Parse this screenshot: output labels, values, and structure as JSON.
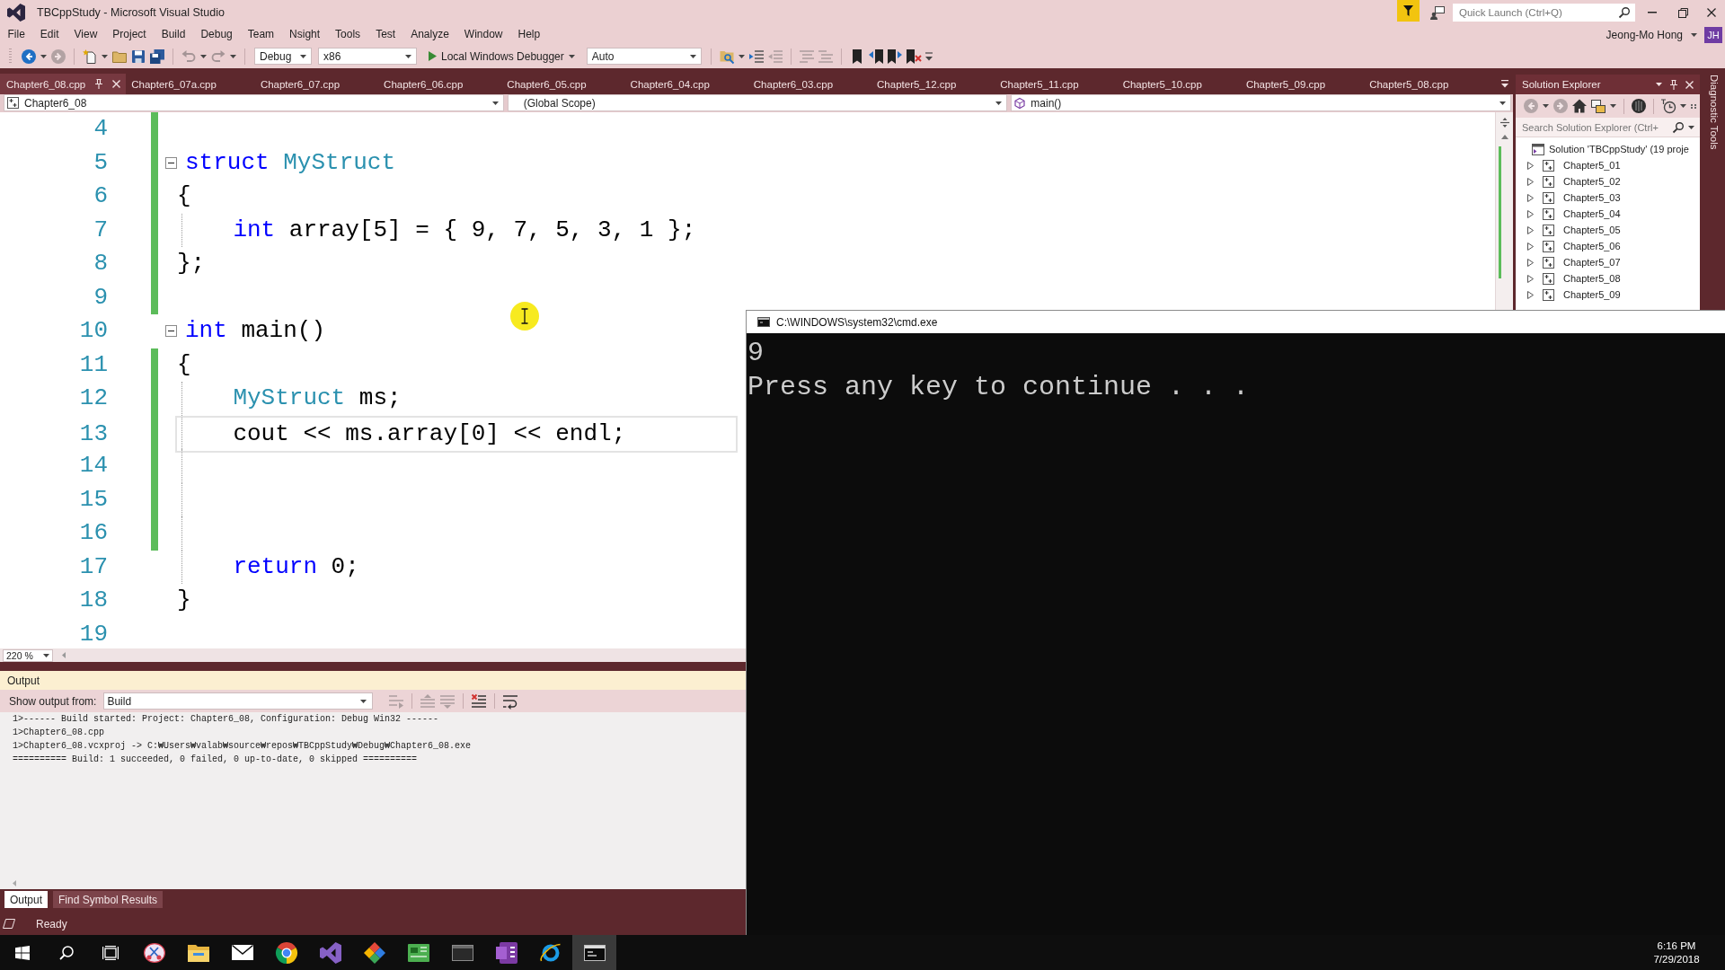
{
  "window": {
    "title": "TBCppStudy - Microsoft Visual Studio",
    "quick_launch": {
      "placeholder": "Quick Launch (Ctrl+Q)"
    }
  },
  "menu": [
    "File",
    "Edit",
    "View",
    "Project",
    "Build",
    "Debug",
    "Team",
    "Nsight",
    "Tools",
    "Test",
    "Analyze",
    "Window",
    "Help"
  ],
  "account": {
    "name": "Jeong-Mo Hong",
    "initials": "JH"
  },
  "toolbar": [
    {
      "kind": "back",
      "disabled": false
    },
    {
      "kind": "forward",
      "disabled": true
    },
    {
      "kind": "new",
      "disabled": false
    },
    {
      "kind": "open",
      "disabled": false
    },
    {
      "kind": "save",
      "disabled": false
    },
    {
      "kind": "saveall",
      "disabled": false
    },
    {
      "kind": "undo",
      "disabled": true
    },
    {
      "kind": "redo",
      "disabled": true
    },
    {
      "kind": "combo",
      "value": "Debug"
    },
    {
      "kind": "combo",
      "value": "x86"
    },
    {
      "kind": "start",
      "label": "Local Windows Debugger"
    },
    {
      "kind": "combo",
      "value": "Auto"
    },
    {
      "kind": "find",
      "disabled": false
    },
    {
      "kind": "indent",
      "disabled": false
    },
    {
      "kind": "outdent",
      "disabled": true
    },
    {
      "kind": "comment",
      "disabled": true
    },
    {
      "kind": "uncomment",
      "disabled": true
    },
    {
      "kind": "bookmark",
      "disabled": false
    },
    {
      "kind": "prevbookmark",
      "disabled": false
    },
    {
      "kind": "nextbookmark",
      "disabled": false
    },
    {
      "kind": "clearbookmarks",
      "disabled": false
    },
    {
      "kind": "more",
      "disabled": false
    }
  ],
  "document_tabs": [
    {
      "label": "Chapter6_08.cpp",
      "selected": true
    },
    {
      "label": "Chapter6_07a.cpp",
      "selected": false
    },
    {
      "label": "Chapter6_07.cpp",
      "selected": false
    },
    {
      "label": "Chapter6_06.cpp",
      "selected": false
    },
    {
      "label": "Chapter6_05.cpp",
      "selected": false
    },
    {
      "label": "Chapter6_04.cpp",
      "selected": false
    },
    {
      "label": "Chapter6_03.cpp",
      "selected": false
    },
    {
      "label": "Chapter5_12.cpp",
      "selected": false
    },
    {
      "label": "Chapter5_11.cpp",
      "selected": false
    },
    {
      "label": "Chapter5_10.cpp",
      "selected": false
    },
    {
      "label": "Chapter5_09.cpp",
      "selected": false
    },
    {
      "label": "Chapter5_08.cpp",
      "selected": false
    }
  ],
  "navigation_bar": {
    "project": "Chapter6_08",
    "scope": "(Global Scope)",
    "member": "main()"
  },
  "editor": {
    "lines": [
      {
        "number": "4",
        "changed": true,
        "indented": false,
        "selected": false
      },
      {
        "number": "5",
        "changed": true,
        "indented": false,
        "selected": false,
        "fold": {
          "expanded": true
        },
        "tokens": [
          {
            "kind": "keyword",
            "text": "struct"
          },
          {
            "kind": "type",
            "text": " MyStruct"
          }
        ]
      },
      {
        "number": "6",
        "changed": true,
        "indented": false,
        "selected": false,
        "tokens": [
          {
            "kind": "plain",
            "text": "{"
          }
        ]
      },
      {
        "number": "7",
        "changed": true,
        "indented": true,
        "selected": false,
        "tokens": [
          {
            "kind": "keyword",
            "text": "int"
          },
          {
            "kind": "plain",
            "text": " array[5] = { 9, 7, 5, 3, 1 };"
          }
        ]
      },
      {
        "number": "8",
        "changed": true,
        "indented": false,
        "selected": false,
        "tokens": [
          {
            "kind": "plain",
            "text": "};"
          }
        ]
      },
      {
        "number": "9",
        "changed": true,
        "indented": false,
        "selected": false
      },
      {
        "number": "10",
        "changed": false,
        "indented": false,
        "selected": false,
        "fold": {
          "expanded": true
        },
        "tokens": [
          {
            "kind": "keyword",
            "text": "int"
          },
          {
            "kind": "plain",
            "text": " main()"
          }
        ]
      },
      {
        "number": "11",
        "changed": true,
        "indented": false,
        "selected": false,
        "tokens": [
          {
            "kind": "plain",
            "text": "{"
          }
        ]
      },
      {
        "number": "12",
        "changed": true,
        "indented": true,
        "selected": false,
        "tokens": [
          {
            "kind": "type",
            "text": "MyStruct"
          },
          {
            "kind": "plain",
            "text": " ms;"
          }
        ]
      },
      {
        "number": "13",
        "changed": true,
        "indented": true,
        "selected": true,
        "tokens": [
          {
            "kind": "plain",
            "text": "cout << ms.array[0] << endl;"
          }
        ]
      },
      {
        "number": "14",
        "changed": true,
        "indented": true,
        "selected": false
      },
      {
        "number": "15",
        "changed": true,
        "indented": true,
        "selected": false
      },
      {
        "number": "16",
        "changed": true,
        "indented": true,
        "selected": false
      },
      {
        "number": "17",
        "changed": false,
        "indented": true,
        "selected": false,
        "tokens": [
          {
            "kind": "keyword",
            "text": "return"
          },
          {
            "kind": "plain",
            "text": " 0;"
          }
        ]
      },
      {
        "number": "18",
        "changed": false,
        "indented": false,
        "selected": false,
        "tokens": [
          {
            "kind": "plain",
            "text": "}"
          }
        ]
      },
      {
        "number": "19",
        "changed": false,
        "indented": false,
        "selected": false
      }
    ],
    "zoom": "220 %"
  },
  "solution_explorer": {
    "title": "Solution Explorer",
    "tools": [
      {
        "kind": "back",
        "disabled": true
      },
      {
        "kind": "forward",
        "disabled": true
      },
      {
        "kind": "home",
        "disabled": false
      },
      {
        "kind": "views",
        "disabled": false
      },
      {
        "kind": "showall",
        "disabled": false
      },
      {
        "kind": "pending",
        "disabled": false
      },
      {
        "kind": "dots",
        "disabled": false
      }
    ],
    "search": {
      "placeholder": "Search Solution Explorer (Ctrl+"
    },
    "tree": [
      {
        "label": "Solution 'TBCppStudy' (19 proje",
        "children": [
          {
            "label": "Chapter5_01",
            "expanded": false
          },
          {
            "label": "Chapter5_02",
            "expanded": false
          },
          {
            "label": "Chapter5_03",
            "expanded": false
          },
          {
            "label": "Chapter5_04",
            "expanded": false
          },
          {
            "label": "Chapter5_05",
            "expanded": false
          },
          {
            "label": "Chapter5_06",
            "expanded": false
          },
          {
            "label": "Chapter5_07",
            "expanded": false
          },
          {
            "label": "Chapter5_08",
            "expanded": false
          },
          {
            "label": "Chapter5_09",
            "expanded": false
          }
        ]
      }
    ]
  },
  "side_tabs": [
    "Diagnostic Tools"
  ],
  "output": {
    "title": "Output",
    "source_label": "Show output from:",
    "source": "Build",
    "tools": [
      {
        "kind": "goto",
        "disabled": true
      },
      {
        "kind": "previous",
        "disabled": true
      },
      {
        "kind": "next",
        "disabled": true
      },
      {
        "kind": "clear",
        "disabled": false
      },
      {
        "kind": "wrap",
        "disabled": false
      }
    ],
    "lines": [
      "1>------ Build started: Project: Chapter6_08, Configuration: Debug Win32 ------",
      "1>Chapter6_08.cpp",
      "1>Chapter6_08.vcxproj -> C:₩Users₩valab₩source₩repos₩TBCppStudy₩Debug₩Chapter6_08.exe",
      "========== Build: 1 succeeded, 0 failed, 0 up-to-date, 0 skipped =========="
    ],
    "tabs": [
      {
        "label": "Output",
        "selected": true
      },
      {
        "label": "Find Symbol Results",
        "selected": false
      }
    ]
  },
  "status_bar": {
    "text": "Ready"
  },
  "console": {
    "title": "C:\\WINDOWS\\system32\\cmd.exe",
    "lines": [
      "9",
      "Press any key to continue . . ."
    ]
  },
  "taskbar": {
    "items": [
      {
        "kind": "start",
        "selected": false
      },
      {
        "kind": "search",
        "selected": false
      },
      {
        "kind": "taskview",
        "selected": false
      },
      {
        "kind": "snip",
        "selected": false
      },
      {
        "kind": "files",
        "selected": false
      },
      {
        "kind": "mail",
        "selected": false
      },
      {
        "kind": "browser",
        "selected": false
      },
      {
        "kind": "studio",
        "selected": false
      },
      {
        "kind": "diamond",
        "selected": false
      },
      {
        "kind": "board",
        "selected": false
      },
      {
        "kind": "window",
        "selected": false
      },
      {
        "kind": "notes",
        "selected": false
      },
      {
        "kind": "globe",
        "selected": false
      },
      {
        "kind": "console",
        "selected": true
      }
    ],
    "time": "6:16 PM",
    "date": "7/29/2018"
  }
}
